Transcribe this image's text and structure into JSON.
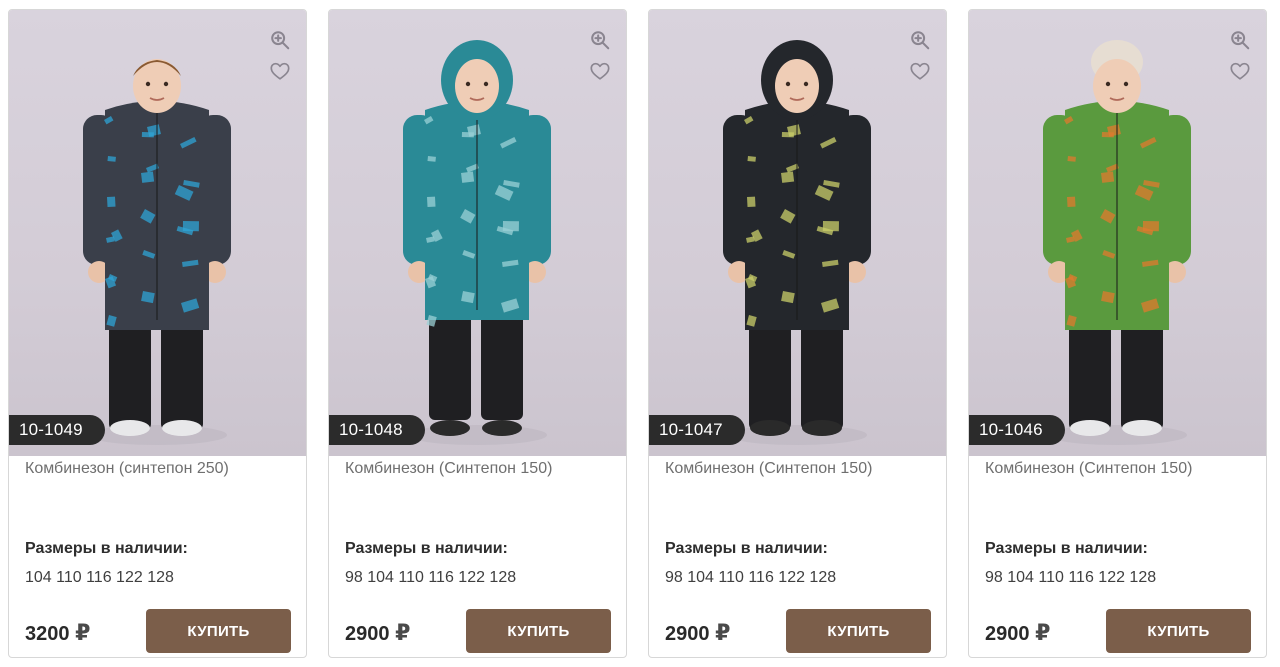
{
  "products": [
    {
      "sku": "10-1049",
      "name": "Комбинезон (синтепон 250)",
      "sizes_title": "Размеры в наличии:",
      "sizes": "104 110 116 122 128",
      "price": "3200",
      "currency": "₽",
      "buy_label": "КУПИТЬ",
      "suit_color": "#3a3f4a",
      "accent_color": "#2fa4d6"
    },
    {
      "sku": "10-1048",
      "name": "Комбинезон (Синтепон 150)",
      "sizes_title": "Размеры в наличии:",
      "sizes": "98 104 110 116 122 128",
      "price": "2900",
      "currency": "₽",
      "buy_label": "КУПИТЬ",
      "suit_color": "#2a8a96",
      "accent_color": "#9bd0d6"
    },
    {
      "sku": "10-1047",
      "name": "Комбинезон (Синтепон 150)",
      "sizes_title": "Размеры в наличии:",
      "sizes": "98 104 110 116 122 128",
      "price": "2900",
      "currency": "₽",
      "buy_label": "КУПИТЬ",
      "suit_color": "#24272c",
      "accent_color": "#c9cf6a"
    },
    {
      "sku": "10-1046",
      "name": "Комбинезон (Синтепон 150)",
      "sizes_title": "Размеры в наличии:",
      "sizes": "98 104 110 116 122 128",
      "price": "2900",
      "currency": "₽",
      "buy_label": "КУПИТЬ",
      "suit_color": "#5a9a3e",
      "accent_color": "#e07a2e"
    }
  ],
  "icons": {
    "zoom": "zoom-in-icon",
    "favorite": "heart-icon"
  },
  "colors": {
    "button": "#7b5e4a",
    "badge": "#2b2b2b",
    "photo_bg": "#d6d0d9"
  }
}
